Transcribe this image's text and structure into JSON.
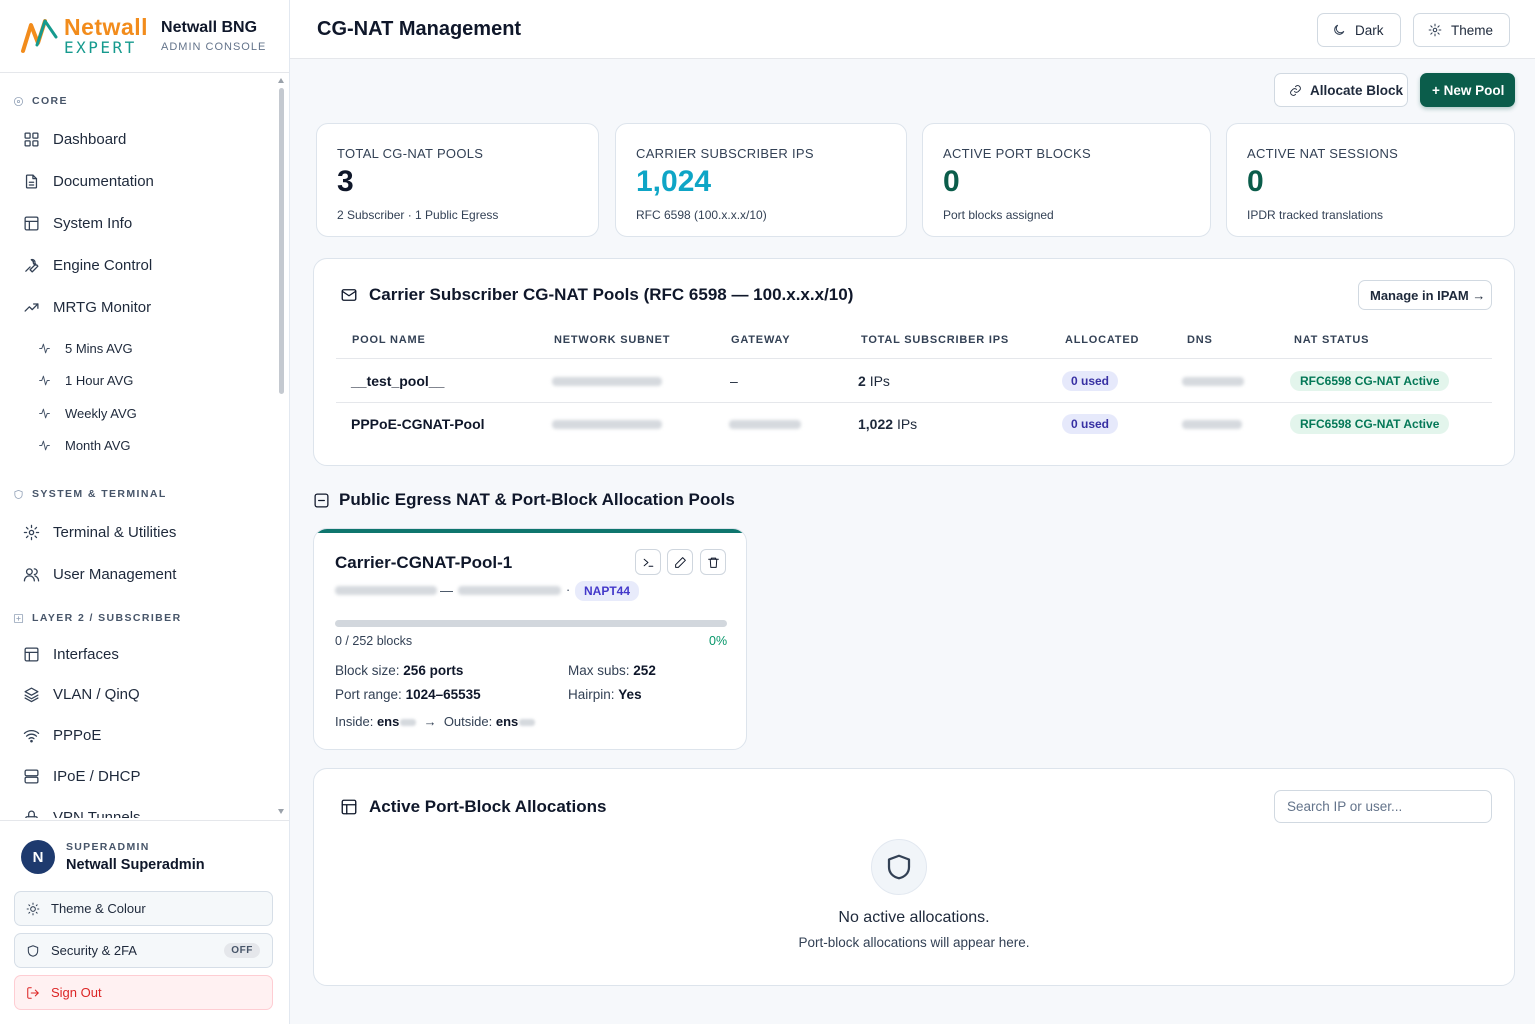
{
  "brand": {
    "logo_top": "Netwall",
    "logo_bottom": "EXPERT",
    "title": "Netwall BNG",
    "subtitle": "ADMIN CONSOLE"
  },
  "nav": {
    "core_label": "CORE",
    "core": [
      {
        "label": "Dashboard",
        "icon": "grid-icon"
      },
      {
        "label": "Documentation",
        "icon": "document-icon"
      },
      {
        "label": "System Info",
        "icon": "table-icon"
      },
      {
        "label": "Engine Control",
        "icon": "wrench-icon"
      },
      {
        "label": "MRTG Monitor",
        "icon": "trending-icon"
      }
    ],
    "mrtg_sub": [
      {
        "label": "5 Mins AVG",
        "icon": "pulse-icon"
      },
      {
        "label": "1 Hour AVG",
        "icon": "pulse-icon"
      },
      {
        "label": "Weekly AVG",
        "icon": "pulse-icon"
      },
      {
        "label": "Month AVG",
        "icon": "pulse-icon"
      }
    ],
    "system_label": "SYSTEM & TERMINAL",
    "system": [
      {
        "label": "Terminal & Utilities",
        "icon": "gear-icon"
      },
      {
        "label": "User Management",
        "icon": "users-icon"
      }
    ],
    "layer2_label": "LAYER 2 / SUBSCRIBER",
    "layer2": [
      {
        "label": "Interfaces",
        "icon": "table-icon"
      },
      {
        "label": "VLAN / QinQ",
        "icon": "layers-icon"
      },
      {
        "label": "PPPoE",
        "icon": "wifi-icon"
      },
      {
        "label": "IPoE / DHCP",
        "icon": "server-icon"
      },
      {
        "label": "VPN Tunnels",
        "icon": "lock-icon"
      }
    ]
  },
  "user": {
    "initial": "N",
    "role": "SUPERADMIN",
    "name": "Netwall Superadmin",
    "theme_label": "Theme & Colour",
    "security_label": "Security & 2FA",
    "security_badge": "OFF",
    "signout_label": "Sign Out"
  },
  "header": {
    "title": "CG-NAT Management",
    "dark_label": "Dark",
    "theme_label": "Theme"
  },
  "actions": {
    "allocate_label": "Allocate Block",
    "new_pool_label": "+ New Pool"
  },
  "stats": [
    {
      "label": "TOTAL CG-NAT POOLS",
      "value": "3",
      "desc": "2 Subscriber · 1 Public Egress",
      "color": "#0f172a"
    },
    {
      "label": "CARRIER SUBSCRIBER IPS",
      "value": "1,024",
      "desc": "RFC 6598 (100.x.x.x/10)",
      "color": "#0ea5c6"
    },
    {
      "label": "ACTIVE PORT BLOCKS",
      "value": "0",
      "desc": "Port blocks assigned",
      "color": "#0b5d4b"
    },
    {
      "label": "ACTIVE NAT SESSIONS",
      "value": "0",
      "desc": "IPDR tracked translations",
      "color": "#0b5d4b"
    }
  ],
  "subscriber_pools": {
    "title": "Carrier Subscriber CG-NAT Pools (RFC 6598 — 100.x.x.x/10)",
    "manage_label": "Manage in IPAM →",
    "columns": [
      "POOL NAME",
      "NETWORK SUBNET",
      "GATEWAY",
      "TOTAL SUBSCRIBER IPS",
      "ALLOCATED",
      "DNS",
      "NAT STATUS"
    ],
    "rows": [
      {
        "name": "__test_pool__",
        "gateway": "–",
        "total_ips": "2",
        "ips_unit": "IPs",
        "allocated": "0 used",
        "status": "RFC6598 CG-NAT Active"
      },
      {
        "name": "PPPoE-CGNAT-Pool",
        "gateway": "",
        "total_ips": "1,022",
        "ips_unit": "IPs",
        "allocated": "0 used",
        "status": "RFC6598 CG-NAT Active"
      }
    ]
  },
  "egress": {
    "heading": "Public Egress NAT & Port-Block Allocation Pools",
    "card": {
      "name": "Carrier-CGNAT-Pool-1",
      "range_sep": "—",
      "dot": "·",
      "mode": "NAPT44",
      "blocks_text": "0 / 252 blocks",
      "used_pct": 0,
      "pct_text": "0%",
      "block_size_label": "Block size:",
      "block_size": "256 ports",
      "max_subs_label": "Max subs:",
      "max_subs": "252",
      "port_range_label": "Port range:",
      "port_range": "1024–65535",
      "hairpin_label": "Hairpin:",
      "hairpin": "Yes",
      "inside_label": "Inside:",
      "inside": "ens",
      "arrow": "→",
      "outside_label": "Outside:",
      "outside": "ens"
    }
  },
  "allocations": {
    "title": "Active Port-Block Allocations",
    "search_placeholder": "Search IP or user...",
    "empty_title": "No active allocations.",
    "empty_sub": "Port-block allocations will appear here."
  }
}
